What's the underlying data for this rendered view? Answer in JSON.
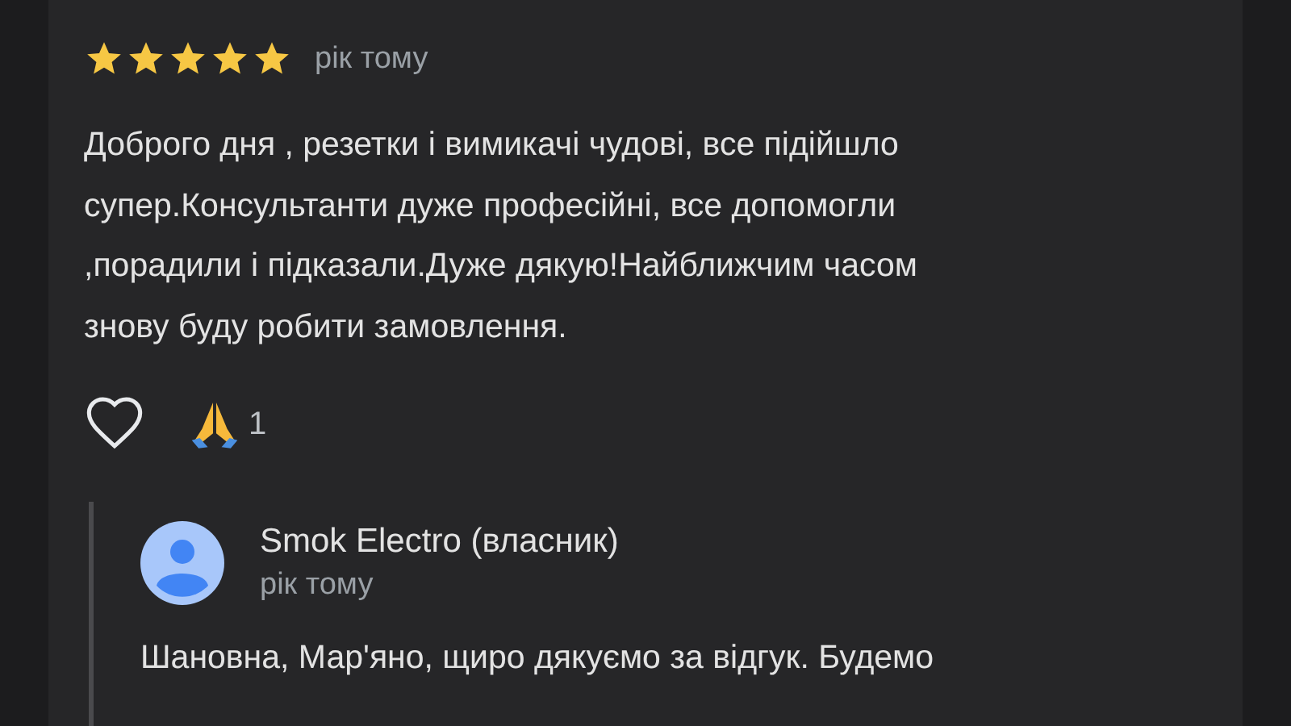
{
  "review": {
    "stars": 5,
    "time": "рік тому",
    "text": "Доброго дня , резетки і вимикачі чудові, все підійшло\nсупер.Консультанти дуже професійні, все допомогли\n,порадили і підказали.Дуже дякую!Найближчим часом\nзнову буду робити замовлення.",
    "liked": false,
    "reaction_count": "1"
  },
  "reply": {
    "author": "Smok Electro (власник)",
    "time": "рік тому",
    "text": "Шановна, Мар'яно, щиро дякуємо за відгук. Будемо"
  }
}
